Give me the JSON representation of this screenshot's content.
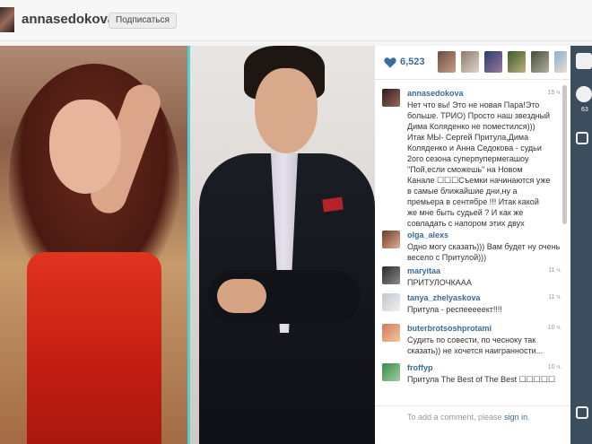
{
  "header": {
    "username": "annasedokova",
    "follow_label": "Подписаться"
  },
  "post": {
    "likes": "6,523",
    "caption": {
      "user": "annasedokova",
      "time": "15 ч.",
      "text": "Нет что вы! Это не новая Пара!Это больше. ТРИО) Просто наш звездный Дима Коляденко не поместился))) Итак МЫ- Сергей Притула,Дима Коляденко и Анна Седокова - судьи 2ого сезона суперпупермегашоу \"Пой,если сможешь\" на Новом Канале ☐☐☐Съемки начинаются уже в самые ближайшие дни,ну а премьера в сентябре !!! Итак какой же мне быть судьей ? И как же совладать с напором этих двух"
    },
    "comments": [
      {
        "user": "olga_alexs",
        "time": "",
        "text": "Одно могу сказать))) Вам будет ну очень весело с Притулой)))"
      },
      {
        "user": "maryitaa",
        "time": "11 ч.",
        "text": "ПРИТУЛОЧКААА"
      },
      {
        "user": "tanya_zhelyaskova",
        "time": "11 ч.",
        "text": "Притула - респееееект!!!!"
      },
      {
        "user": "buterbrotsoshprotami",
        "time": "10 ч.",
        "text": "Судить по совести, по чесноку так сказать)) не хочется наигранности..."
      },
      {
        "user": "froffyp",
        "time": "10 ч.",
        "text": "Притула The Best of The Best ☐☐☐☐☐"
      }
    ],
    "add_comment": {
      "prefix": "To add a comment, please ",
      "link": "sign in",
      "suffix": "."
    }
  },
  "rightrail": {
    "count": "63"
  },
  "colors": {
    "accent": "#3b6b9a",
    "divider": "#4ed2d6"
  }
}
